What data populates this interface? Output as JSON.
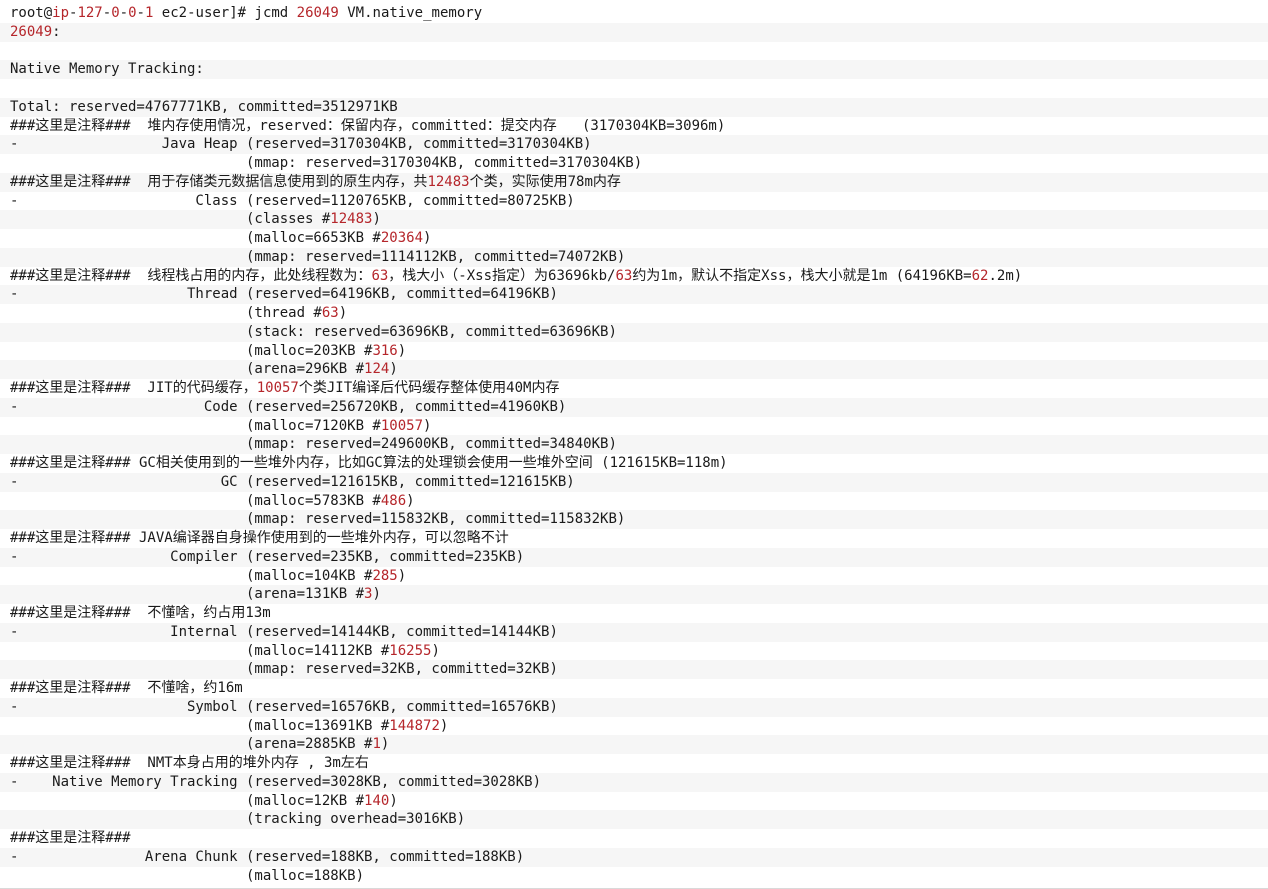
{
  "terminal": {
    "lines": [
      [
        {
          "t": "root@"
        },
        {
          "t": "ip",
          "c": "host"
        },
        {
          "t": "-"
        },
        {
          "t": "127",
          "c": "num"
        },
        {
          "t": "-"
        },
        {
          "t": "0",
          "c": "num"
        },
        {
          "t": "-"
        },
        {
          "t": "0",
          "c": "num"
        },
        {
          "t": "-"
        },
        {
          "t": "1",
          "c": "num"
        },
        {
          "t": " ec2-user]# jcmd "
        },
        {
          "t": "26049",
          "c": "num"
        },
        {
          "t": " VM.native_memory"
        }
      ],
      [
        {
          "t": "26049",
          "c": "num"
        },
        {
          "t": ":"
        }
      ],
      [
        {
          "t": ""
        }
      ],
      [
        {
          "t": "Native Memory Tracking:"
        }
      ],
      [
        {
          "t": ""
        }
      ],
      [
        {
          "t": "Total: reserved=4767771KB, committed=3512971KB"
        }
      ],
      [
        {
          "t": "###这里是注释###  堆内存使用情况，reserved：保留内存，committed：提交内存   (3170304KB=3096m)"
        }
      ],
      [
        {
          "t": "-                 Java Heap (reserved=3170304KB, committed=3170304KB)"
        }
      ],
      [
        {
          "t": "                            (mmap: reserved=3170304KB, committed=3170304KB)"
        }
      ],
      [
        {
          "t": "###这里是注释###  用于存储类元数据信息使用到的原生内存，共"
        },
        {
          "t": "12483",
          "c": "num"
        },
        {
          "t": "个类，实际使用78m内存"
        }
      ],
      [
        {
          "t": "-                     Class (reserved=1120765KB, committed=80725KB)"
        }
      ],
      [
        {
          "t": "                            (classes #"
        },
        {
          "t": "12483",
          "c": "num"
        },
        {
          "t": ")"
        }
      ],
      [
        {
          "t": "                            (malloc=6653KB #"
        },
        {
          "t": "20364",
          "c": "num"
        },
        {
          "t": ")"
        }
      ],
      [
        {
          "t": "                            (mmap: reserved=1114112KB, committed=74072KB)"
        }
      ],
      [
        {
          "t": "###这里是注释###  线程栈占用的内存，此处线程数为："
        },
        {
          "t": "63",
          "c": "num"
        },
        {
          "t": "，栈大小（-Xss指定）为63696kb/"
        },
        {
          "t": "63",
          "c": "num"
        },
        {
          "t": "约为1m，默认不指定Xss，栈大小就是1m (64196KB="
        },
        {
          "t": "62",
          "c": "num"
        },
        {
          "t": ".2m)"
        }
      ],
      [
        {
          "t": "-                    Thread (reserved=64196KB, committed=64196KB)"
        }
      ],
      [
        {
          "t": "                            (thread #"
        },
        {
          "t": "63",
          "c": "num"
        },
        {
          "t": ")"
        }
      ],
      [
        {
          "t": "                            (stack: reserved=63696KB, committed=63696KB)"
        }
      ],
      [
        {
          "t": "                            (malloc=203KB #"
        },
        {
          "t": "316",
          "c": "num"
        },
        {
          "t": ")"
        }
      ],
      [
        {
          "t": "                            (arena=296KB #"
        },
        {
          "t": "124",
          "c": "num"
        },
        {
          "t": ")"
        }
      ],
      [
        {
          "t": "###这里是注释###  JIT的代码缓存，"
        },
        {
          "t": "10057",
          "c": "num"
        },
        {
          "t": "个类JIT编译后代码缓存整体使用40M内存"
        }
      ],
      [
        {
          "t": "-                      Code (reserved=256720KB, committed=41960KB)"
        }
      ],
      [
        {
          "t": "                            (malloc=7120KB #"
        },
        {
          "t": "10057",
          "c": "num"
        },
        {
          "t": ")"
        }
      ],
      [
        {
          "t": "                            (mmap: reserved=249600KB, committed=34840KB)"
        }
      ],
      [
        {
          "t": "###这里是注释### GC相关使用到的一些堆外内存，比如GC算法的处理锁会使用一些堆外空间 (121615KB=118m)"
        }
      ],
      [
        {
          "t": "-                        GC (reserved=121615KB, committed=121615KB)"
        }
      ],
      [
        {
          "t": "                            (malloc=5783KB #"
        },
        {
          "t": "486",
          "c": "num"
        },
        {
          "t": ")"
        }
      ],
      [
        {
          "t": "                            (mmap: reserved=115832KB, committed=115832KB)"
        }
      ],
      [
        {
          "t": "###这里是注释### JAVA编译器自身操作使用到的一些堆外内存，可以忽略不计"
        }
      ],
      [
        {
          "t": "-                  Compiler (reserved=235KB, committed=235KB)"
        }
      ],
      [
        {
          "t": "                            (malloc=104KB #"
        },
        {
          "t": "285",
          "c": "num"
        },
        {
          "t": ")"
        }
      ],
      [
        {
          "t": "                            (arena=131KB #"
        },
        {
          "t": "3",
          "c": "num"
        },
        {
          "t": ")"
        }
      ],
      [
        {
          "t": "###这里是注释###  不懂啥，约占用13m"
        }
      ],
      [
        {
          "t": "-                  Internal (reserved=14144KB, committed=14144KB)"
        }
      ],
      [
        {
          "t": "                            (malloc=14112KB #"
        },
        {
          "t": "16255",
          "c": "num"
        },
        {
          "t": ")"
        }
      ],
      [
        {
          "t": "                            (mmap: reserved=32KB, committed=32KB)"
        }
      ],
      [
        {
          "t": "###这里是注释###  不懂啥，约16m"
        }
      ],
      [
        {
          "t": "-                    Symbol (reserved=16576KB, committed=16576KB)"
        }
      ],
      [
        {
          "t": "                            (malloc=13691KB #"
        },
        {
          "t": "144872",
          "c": "num"
        },
        {
          "t": ")"
        }
      ],
      [
        {
          "t": "                            (arena=2885KB #"
        },
        {
          "t": "1",
          "c": "num"
        },
        {
          "t": ")"
        }
      ],
      [
        {
          "t": "###这里是注释###  NMT本身占用的堆外内存 , 3m左右"
        }
      ],
      [
        {
          "t": "-    Native Memory Tracking (reserved=3028KB, committed=3028KB)"
        }
      ],
      [
        {
          "t": "                            (malloc=12KB #"
        },
        {
          "t": "140",
          "c": "num"
        },
        {
          "t": ")"
        }
      ],
      [
        {
          "t": "                            (tracking overhead=3016KB)"
        }
      ],
      [
        {
          "t": "###这里是注释###"
        }
      ],
      [
        {
          "t": "-               Arena Chunk (reserved=188KB, committed=188KB)"
        }
      ],
      [
        {
          "t": "                            (malloc=188KB)"
        }
      ]
    ]
  }
}
